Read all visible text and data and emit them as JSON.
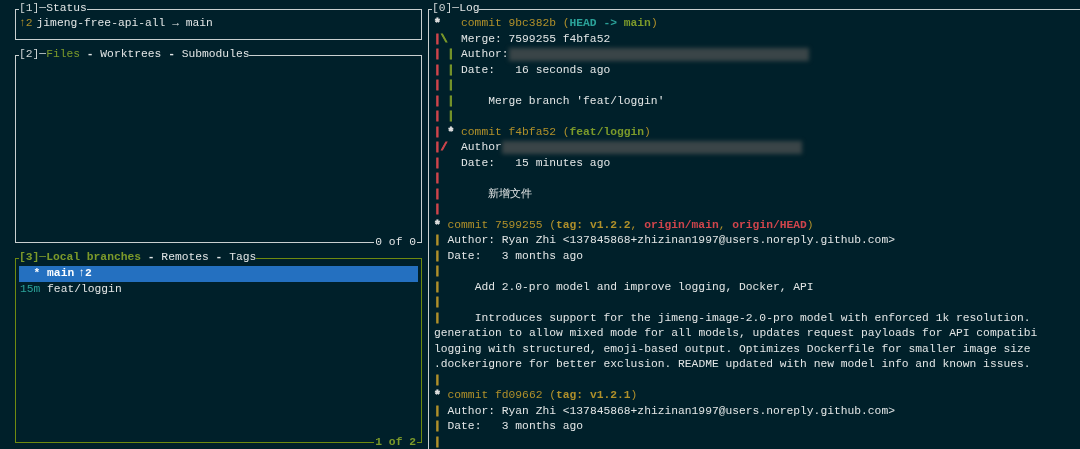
{
  "status": {
    "title": [
      {
        "kind": "number",
        "text": "[1]─"
      },
      {
        "kind": "tab",
        "text": "Status",
        "selected": false
      }
    ],
    "ahead": "↑2",
    "repo": "jimeng-free-api-all → main"
  },
  "files": {
    "active": false,
    "title": [
      {
        "kind": "number",
        "text": "[2]─"
      },
      {
        "kind": "tab",
        "text": "Files",
        "selected": true
      },
      {
        "kind": "separator",
        "text": "-"
      },
      {
        "kind": "tab",
        "text": "Worktrees",
        "selected": false
      },
      {
        "kind": "separator",
        "text": "-"
      },
      {
        "kind": "tab",
        "text": "Submodules",
        "selected": false
      }
    ],
    "footer": "0 of 0"
  },
  "branches": {
    "active": true,
    "title": [
      {
        "kind": "number",
        "text": "[3]─"
      },
      {
        "kind": "tab",
        "text": "Local branches",
        "selected": true
      },
      {
        "kind": "separator",
        "text": "-"
      },
      {
        "kind": "tab",
        "text": "Remotes",
        "selected": false
      },
      {
        "kind": "separator",
        "text": "-"
      },
      {
        "kind": "tab",
        "text": "Tags",
        "selected": false
      }
    ],
    "footer": "1 of 2",
    "items": [
      {
        "recency": "*",
        "name": "main",
        "status": "↑2",
        "selected": true
      },
      {
        "recency": "15m",
        "name": "feat/loggin",
        "selected": false
      }
    ]
  },
  "log": {
    "title": [
      {
        "kind": "number",
        "text": "[0]─"
      },
      {
        "kind": "tab",
        "text": "Log",
        "selected": false
      }
    ],
    "lines": [
      {
        "graph": [
          {
            "kind": "edge",
            "char": "*",
            "color": "#e0e0e0"
          },
          {
            "kind": "gap"
          },
          {
            "kind": "gap"
          },
          {
            "kind": "gap"
          }
        ],
        "kind": "text",
        "parts": [
          {
            "text": "commit 9bc382b (",
            "kind": "hash"
          },
          {
            "text": "HEAD -> ",
            "kind": "head"
          },
          {
            "text": "main",
            "kind": "local"
          },
          {
            "text": ")",
            "kind": "hash"
          }
        ]
      },
      {
        "graph": [
          {
            "kind": "edge",
            "char": "|",
            "color": "#d0454c"
          },
          {
            "kind": "edge",
            "char": "\\",
            "color": "#7c9a2a"
          },
          {
            "kind": "gap"
          },
          {
            "kind": "gap"
          }
        ],
        "kind": "text",
        "parts": [
          {
            "text": "Merge: 7599255 f4bfa52",
            "kind": "plain"
          }
        ]
      },
      {
        "graph": [
          {
            "kind": "edge",
            "char": "|",
            "color": "#d0454c"
          },
          {
            "kind": "gap"
          },
          {
            "kind": "edge",
            "char": "|",
            "color": "#7c9a2a"
          },
          {
            "kind": "gap"
          }
        ],
        "kind": "text",
        "parts": [
          {
            "text": "Author:",
            "kind": "plain"
          },
          {
            "kind": "redacted"
          }
        ]
      },
      {
        "graph": [
          {
            "kind": "edge",
            "char": "|",
            "color": "#d0454c"
          },
          {
            "kind": "gap"
          },
          {
            "kind": "edge",
            "char": "|",
            "color": "#7c9a2a"
          },
          {
            "kind": "gap"
          }
        ],
        "kind": "text",
        "parts": [
          {
            "text": "Date:   16 seconds ago",
            "kind": "plain"
          }
        ]
      },
      {
        "graph": [
          {
            "kind": "edge",
            "char": "|",
            "color": "#d0454c"
          },
          {
            "kind": "gap"
          },
          {
            "kind": "edge",
            "char": "|",
            "color": "#7c9a2a"
          },
          {
            "kind": "gap"
          }
        ],
        "kind": "blank"
      },
      {
        "graph": [
          {
            "kind": "edge",
            "char": "|",
            "color": "#d0454c"
          },
          {
            "kind": "gap"
          },
          {
            "kind": "edge",
            "char": "|",
            "color": "#7c9a2a"
          },
          {
            "kind": "gap"
          }
        ],
        "kind": "message",
        "parts": [
          {
            "text": "Merge branch 'feat/loggin'",
            "kind": "plain"
          }
        ]
      },
      {
        "graph": [
          {
            "kind": "edge",
            "char": "|",
            "color": "#d0454c"
          },
          {
            "kind": "gap"
          },
          {
            "kind": "edge",
            "char": "|",
            "color": "#7c9a2a"
          },
          {
            "kind": "gap"
          }
        ],
        "kind": "blank"
      },
      {
        "graph": [
          {
            "kind": "edge",
            "char": "|",
            "color": "#d0454c"
          },
          {
            "kind": "gap"
          },
          {
            "kind": "edge",
            "char": "*",
            "color": "#e0e0e0"
          },
          {
            "kind": "gap"
          }
        ],
        "kind": "text",
        "parts": [
          {
            "text": "commit f4bfa52 (",
            "kind": "hash"
          },
          {
            "text": "feat/loggin",
            "kind": "local"
          },
          {
            "text": ")",
            "kind": "hash"
          }
        ]
      },
      {
        "graph": [
          {
            "kind": "edge",
            "char": "|",
            "color": "#d0454c"
          },
          {
            "kind": "edge",
            "char": "/",
            "color": "#d0454c"
          },
          {
            "kind": "gap"
          },
          {
            "kind": "gap"
          }
        ],
        "kind": "text",
        "parts": [
          {
            "text": "Author",
            "kind": "plain"
          },
          {
            "kind": "redacted"
          }
        ]
      },
      {
        "graph": [
          {
            "kind": "edge",
            "char": "|",
            "color": "#d0454c"
          },
          {
            "kind": "gap"
          },
          {
            "kind": "gap"
          },
          {
            "kind": "gap"
          }
        ],
        "kind": "text",
        "parts": [
          {
            "text": "Date:   15 minutes ago",
            "kind": "plain"
          }
        ]
      },
      {
        "graph": [
          {
            "kind": "edge",
            "char": "|",
            "color": "#d0454c"
          },
          {
            "kind": "gap"
          },
          {
            "kind": "gap"
          },
          {
            "kind": "gap"
          }
        ],
        "kind": "blank"
      },
      {
        "graph": [
          {
            "kind": "edge",
            "char": "|",
            "color": "#d0454c"
          },
          {
            "kind": "gap"
          },
          {
            "kind": "gap"
          },
          {
            "kind": "gap"
          }
        ],
        "kind": "message",
        "parts": [
          {
            "text": "新增文件",
            "kind": "plain"
          }
        ]
      },
      {
        "graph": [
          {
            "kind": "edge",
            "char": "|",
            "color": "#d0454c"
          },
          {
            "kind": "gap"
          },
          {
            "kind": "gap"
          },
          {
            "kind": "gap"
          }
        ],
        "kind": "blank"
      },
      {
        "graph": [
          {
            "kind": "edge",
            "char": "*",
            "color": "#e0e0e0"
          },
          {
            "kind": "gap"
          }
        ],
        "kind": "text",
        "parts": [
          {
            "text": "commit 7599255 (",
            "kind": "hash"
          },
          {
            "text": "tag: v1.2.2",
            "kind": "tag"
          },
          {
            "text": ", ",
            "kind": "hash"
          },
          {
            "text": "origin/main",
            "kind": "remote"
          },
          {
            "text": ", ",
            "kind": "hash"
          },
          {
            "text": "origin/HEAD",
            "kind": "remote"
          },
          {
            "text": ")",
            "kind": "hash"
          }
        ]
      },
      {
        "graph": [
          {
            "kind": "edge",
            "char": "|",
            "color": "#b0902a"
          },
          {
            "kind": "gap"
          }
        ],
        "kind": "text",
        "parts": [
          {
            "text": "Author: Ryan Zhi <137845868+zhizinan1997@users.noreply.github.com>",
            "kind": "plain"
          }
        ]
      },
      {
        "graph": [
          {
            "kind": "edge",
            "char": "|",
            "color": "#b0902a"
          },
          {
            "kind": "gap"
          }
        ],
        "kind": "text",
        "parts": [
          {
            "text": "Date:   3 months ago",
            "kind": "plain"
          }
        ]
      },
      {
        "graph": [
          {
            "kind": "edge",
            "char": "|",
            "color": "#b0902a"
          },
          {
            "kind": "gap"
          }
        ],
        "kind": "blank"
      },
      {
        "graph": [
          {
            "kind": "edge",
            "char": "|",
            "color": "#b0902a"
          },
          {
            "kind": "gap"
          }
        ],
        "kind": "message",
        "parts": [
          {
            "text": "Add 2.0-pro model and improve logging, Docker, API",
            "kind": "plain"
          }
        ]
      },
      {
        "graph": [
          {
            "kind": "edge",
            "char": "|",
            "color": "#b0902a"
          },
          {
            "kind": "gap"
          }
        ],
        "kind": "blank"
      },
      {
        "graph": [
          {
            "kind": "edge",
            "char": "|",
            "color": "#b0902a"
          },
          {
            "kind": "gap"
          }
        ],
        "kind": "message",
        "parts": [
          {
            "text": "Introduces support for the jimeng-image-2.0-pro model with enforced 1k resolution.",
            "kind": "plain"
          }
        ]
      },
      {
        "kind": "wrap",
        "parts": [
          {
            "text": "generation to allow mixed mode for all models, updates request payloads for API compatibi",
            "kind": "plain"
          }
        ]
      },
      {
        "kind": "wrap",
        "parts": [
          {
            "text": "logging with structured, emoji-based output. Optimizes Dockerfile for smaller image size",
            "kind": "plain"
          }
        ]
      },
      {
        "kind": "wrap",
        "parts": [
          {
            "text": ".dockerignore for better exclusion. README updated with new model info and known issues.",
            "kind": "plain"
          }
        ]
      },
      {
        "graph": [
          {
            "kind": "edge",
            "char": "|",
            "color": "#b0902a"
          },
          {
            "kind": "gap"
          }
        ],
        "kind": "blank"
      },
      {
        "graph": [
          {
            "kind": "edge",
            "char": "*",
            "color": "#e0e0e0"
          },
          {
            "kind": "gap"
          }
        ],
        "kind": "text",
        "parts": [
          {
            "text": "commit fd09662 (",
            "kind": "hash"
          },
          {
            "text": "tag: v1.2.1",
            "kind": "tag"
          },
          {
            "text": ")",
            "kind": "hash"
          }
        ]
      },
      {
        "graph": [
          {
            "kind": "edge",
            "char": "|",
            "color": "#b0902a"
          },
          {
            "kind": "gap"
          }
        ],
        "kind": "text",
        "parts": [
          {
            "text": "Author: Ryan Zhi <137845868+zhizinan1997@users.noreply.github.com>",
            "kind": "plain"
          }
        ]
      },
      {
        "graph": [
          {
            "kind": "edge",
            "char": "|",
            "color": "#b0902a"
          },
          {
            "kind": "gap"
          }
        ],
        "kind": "text",
        "parts": [
          {
            "text": "Date:   3 months ago",
            "kind": "plain"
          }
        ]
      },
      {
        "graph": [
          {
            "kind": "edge",
            "char": "|",
            "color": "#b0902a"
          },
          {
            "kind": "gap"
          }
        ],
        "kind": "blank"
      }
    ]
  }
}
